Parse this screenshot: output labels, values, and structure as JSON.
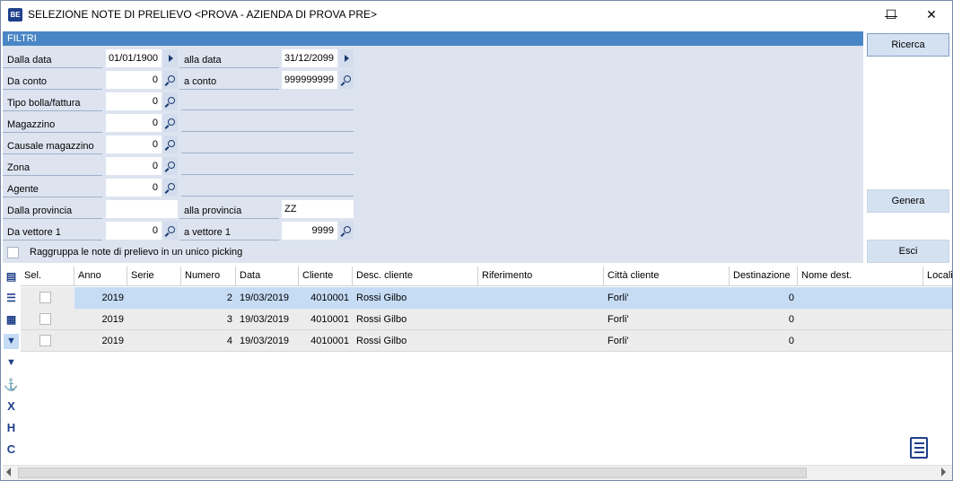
{
  "window": {
    "title": "SELEZIONE NOTE DI PRELIEVO <PROVA - AZIENDA DI PROVA PRE>",
    "app_icon": "BE",
    "minimize_glyph": "—",
    "maximize_glyph": "☐",
    "close_glyph": "✕"
  },
  "filters": {
    "header": "FILTRI",
    "dalla_data": {
      "label": "Dalla data",
      "value": "01/01/1900"
    },
    "alla_data": {
      "label": "alla data",
      "value": "31/12/2099"
    },
    "da_conto": {
      "label": "Da conto",
      "value": "0"
    },
    "a_conto": {
      "label": "a conto",
      "value": "999999999"
    },
    "tipo_bolla": {
      "label": "Tipo bolla/fattura",
      "value": "0"
    },
    "magazzino": {
      "label": "Magazzino",
      "value": "0"
    },
    "causale": {
      "label": "Causale magazzino",
      "value": "0"
    },
    "zona": {
      "label": "Zona",
      "value": "0"
    },
    "agente": {
      "label": "Agente",
      "value": "0"
    },
    "dalla_provincia": {
      "label": "Dalla provincia",
      "value": ""
    },
    "alla_provincia": {
      "label": "alla provincia",
      "value": "ZZ"
    },
    "da_vettore": {
      "label": "Da vettore 1",
      "value": "0"
    },
    "a_vettore": {
      "label": "a vettore 1",
      "value": "9999"
    },
    "raggruppa": {
      "label": "Raggruppa le note di prelievo in un unico picking",
      "checked": false
    }
  },
  "actions": {
    "ricerca": "Ricerca",
    "genera": "Genera",
    "esci": "Esci"
  },
  "toolbar_icons": [
    "grid-view-icon",
    "list-view-icon",
    "table-view-icon",
    "filter-icon",
    "filter-clear-icon",
    "anchor-icon",
    "column-x-icon",
    "column-h-icon",
    "column-c-icon"
  ],
  "grid": {
    "columns": [
      "Sel.",
      "Anno",
      "Serie",
      "Numero",
      "Data",
      "Cliente",
      "Desc. cliente",
      "Riferimento",
      "Città cliente",
      "Destinazione",
      "Nome dest.",
      "Località"
    ],
    "rows": [
      {
        "selected": false,
        "anno": "2019",
        "serie": "",
        "numero": "2",
        "data": "19/03/2019",
        "cliente": "4010001",
        "desc_cliente": "Rossi Gilbo",
        "riferimento": "",
        "citta": "Forli'",
        "destinazione": "0",
        "nome_dest": "",
        "localita": ""
      },
      {
        "selected": false,
        "anno": "2019",
        "serie": "",
        "numero": "3",
        "data": "19/03/2019",
        "cliente": "4010001",
        "desc_cliente": "Rossi Gilbo",
        "riferimento": "",
        "citta": "Forli'",
        "destinazione": "0",
        "nome_dest": "",
        "localita": ""
      },
      {
        "selected": false,
        "anno": "2019",
        "serie": "",
        "numero": "4",
        "data": "19/03/2019",
        "cliente": "4010001",
        "desc_cliente": "Rossi Gilbo",
        "riferimento": "",
        "citta": "Forli'",
        "destinazione": "0",
        "nome_dest": "",
        "localita": ""
      }
    ]
  },
  "colors": {
    "header_blue": "#4a86c5",
    "filter_bg": "#dde4f0",
    "selected_row": "#c6dcf5",
    "alt_row": "#ececec",
    "button_bg": "#d4e1f1",
    "icon_blue": "#1e3f8a"
  }
}
